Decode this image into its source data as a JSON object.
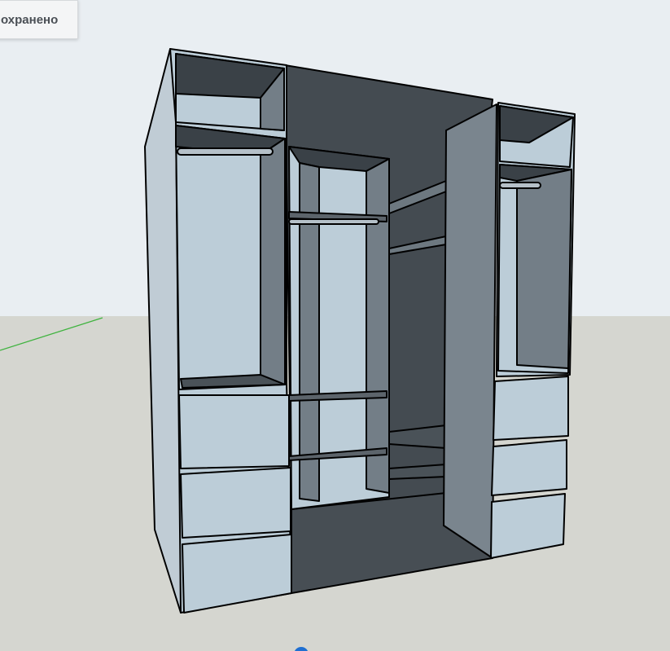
{
  "notification": {
    "status_text": "охранено"
  },
  "colors": {
    "sky": "#e9eef2",
    "ground": "#d5d6d0",
    "panel_light": "#bccdd8",
    "panel_mid": "#7a858e",
    "panel_dark": "#444b51",
    "green_axis": "#3fb33f",
    "outline": "#000000"
  },
  "scene": {
    "model": "wardrobe",
    "view": "3d-perspective"
  }
}
